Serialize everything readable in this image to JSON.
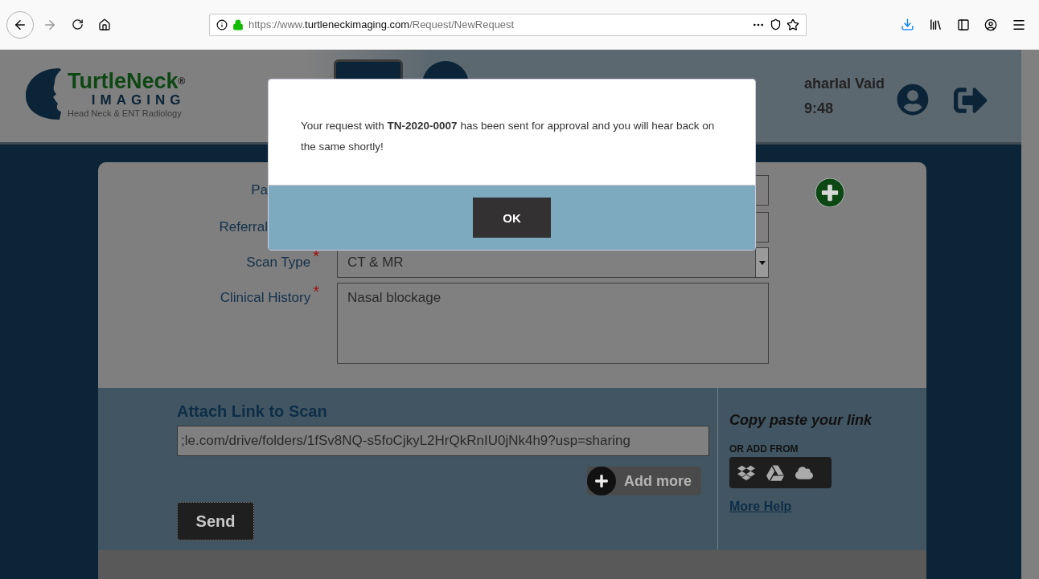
{
  "browser": {
    "url": {
      "scheme": "https://www.",
      "domain": "turtleneckimaging.com",
      "path": "/Request/NewRequest"
    }
  },
  "header": {
    "logo": {
      "brand": "TurtleNeck",
      "reg": "®",
      "sub": "IMAGING",
      "tagline": "Head Neck & ENT Radiology"
    },
    "user_name": "aharlal Vaid",
    "time": "9:48"
  },
  "form": {
    "fields": [
      {
        "kind": "input",
        "label": "Pa",
        "covered": true
      },
      {
        "kind": "input",
        "label": "Referral",
        "covered": true
      },
      {
        "kind": "select",
        "label": "Scan Type",
        "required_mark": "*",
        "value": "CT & MR"
      },
      {
        "kind": "textarea",
        "label": "Clinical History",
        "required_mark": "*",
        "value": "Nasal blockage"
      }
    ]
  },
  "attach": {
    "title": "Attach Link to Scan",
    "link": ";le.com/drive/folders/1fSv8NQ-s5foCjkyL2HrQkRnIU0jNk4h9?usp=sharing",
    "add_more": "Add more",
    "send": "Send",
    "hint": "Copy paste your link",
    "or_add_from": "OR ADD FROM",
    "more_help": "More Help"
  },
  "dialog": {
    "message": "Your request with **TN-2020-0007** has been sent for approval and you will hear back on the same shortly!",
    "ok": "OK"
  }
}
